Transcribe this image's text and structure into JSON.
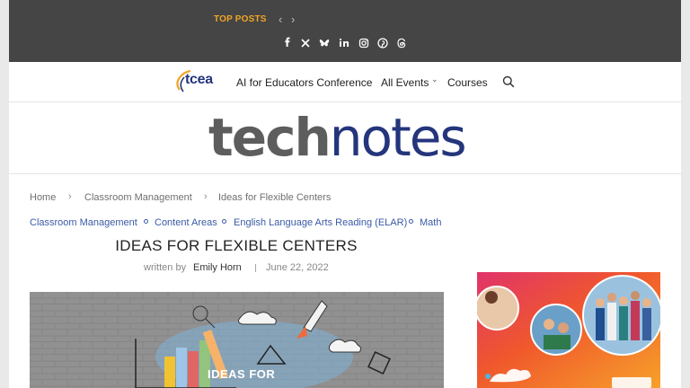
{
  "topbar": {
    "top_posts_label": "TOP POSTS",
    "prev_icon": "chevron-left-icon",
    "next_icon": "chevron-right-icon",
    "prev_glyph": "‹",
    "next_glyph": "›",
    "social": [
      "facebook-icon",
      "x-icon",
      "bluesky-icon",
      "linkedin-icon",
      "instagram-icon",
      "pinterest-icon",
      "threads-icon"
    ]
  },
  "nav": {
    "logo_text": "tcea",
    "items": [
      {
        "label": "AI for Educators Conference"
      },
      {
        "label": "All Events"
      },
      {
        "label": "Courses"
      }
    ],
    "dropdown_glyph": "⌄"
  },
  "brand": {
    "part1": "tech",
    "part2": "notes"
  },
  "breadcrumb": {
    "items": [
      "Home",
      "Classroom Management",
      "Ideas for Flexible Centers"
    ],
    "separator": "›"
  },
  "categories": [
    "Classroom Management",
    "Content Areas",
    "English Language Arts Reading (ELAR)",
    "Math"
  ],
  "article": {
    "title": "IDEAS FOR FLEXIBLE CENTERS",
    "written_by": "written by",
    "author": "Emily Horn",
    "date": "June 22, 2022"
  },
  "hero": {
    "overlay_text": "IDEAS FOR"
  },
  "colors": {
    "topbar_bg": "#454545",
    "accent_orange": "#f0a524",
    "brand_navy": "#24357c",
    "brand_gray": "#5d5d5d",
    "link_blue": "#3a5aa5"
  }
}
